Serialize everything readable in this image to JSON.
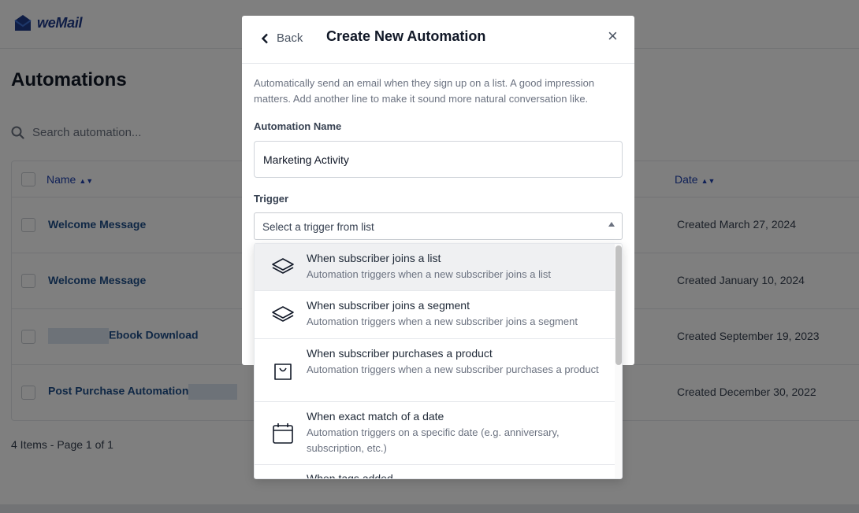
{
  "app": {
    "logo_text": "weMail",
    "brand_color": "#1e3a8a"
  },
  "page": {
    "title": "Automations",
    "search_placeholder": "Search automation...",
    "table": {
      "columns": {
        "name": "Name",
        "date": "Date"
      },
      "rows": [
        {
          "name": "Welcome Message",
          "date": "Created March 27, 2024"
        },
        {
          "name": "Welcome Message",
          "date": "Created January 10, 2024"
        },
        {
          "name": "Ebook Download",
          "date": "Created September 19, 2023"
        },
        {
          "name": "Post Purchase Automation",
          "date": "Created December 30, 2022"
        }
      ]
    },
    "footer": "4 Items - Page 1 of 1"
  },
  "modal": {
    "back_label": "Back",
    "title": "Create New Automation",
    "close_symbol": "×",
    "description": "Automatically send an email when they sign up on a list. A good impression matters. Add another line to make it sound more natural conversation like.",
    "name_label": "Automation Name",
    "name_value": "Marketing Activity",
    "trigger_label": "Trigger",
    "trigger_placeholder": "Select a trigger from list"
  },
  "trigger_options": [
    {
      "title": "When subscriber joins a list",
      "description": "Automation triggers when a new subscriber joins a list",
      "icon": "layers-icon"
    },
    {
      "title": "When subscriber joins a segment",
      "description": "Automation triggers when a new subscriber joins a segment",
      "icon": "layers-icon"
    },
    {
      "title": "When subscriber purchases a product",
      "description": "Automation triggers when a new subscriber purchases a product",
      "icon": "shopping-bag-icon"
    },
    {
      "title": "When exact match of a date",
      "description": "Automation triggers on a specific date (e.g. anniversary, subscription, etc.)",
      "icon": "calendar-icon"
    },
    {
      "title": "When tags added",
      "description": "",
      "icon": "tag-icon"
    }
  ]
}
